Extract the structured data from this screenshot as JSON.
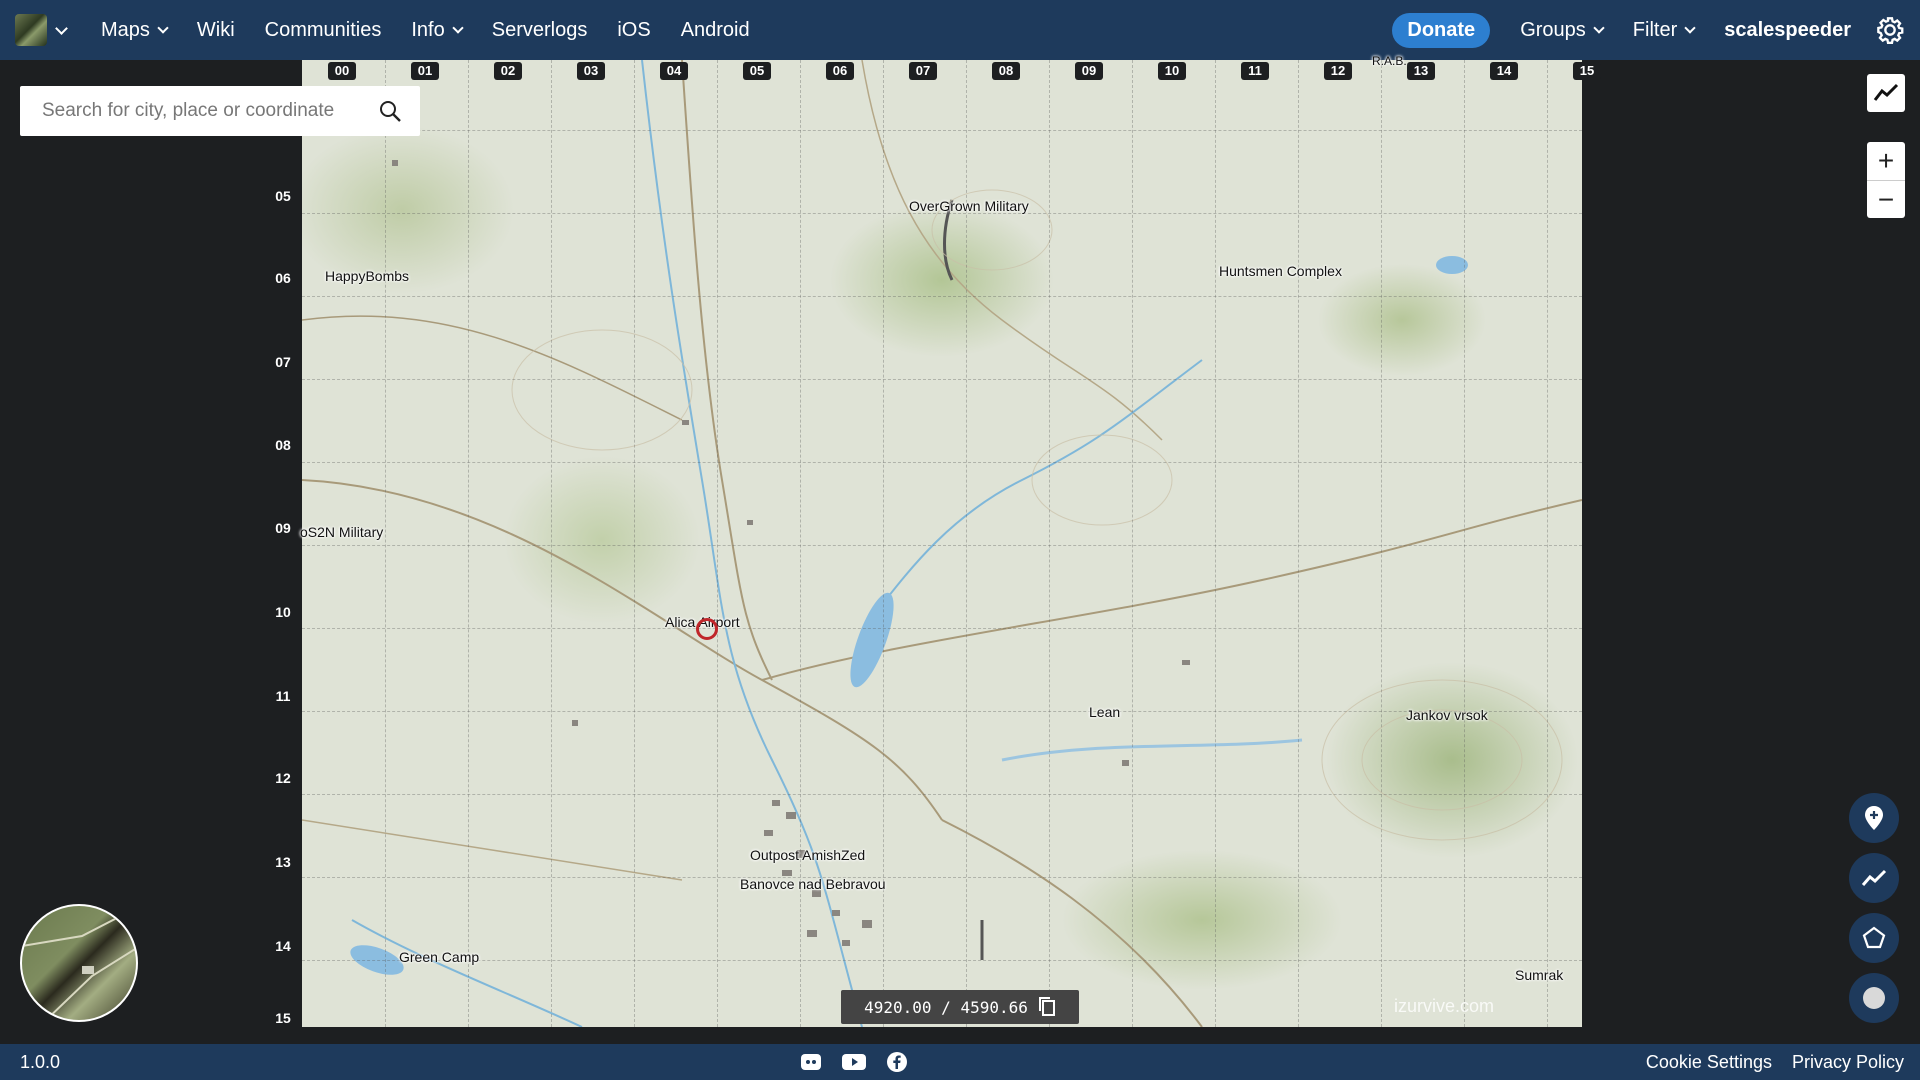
{
  "navbar": {
    "logo_icon": "map-game-logo",
    "items": [
      {
        "label": "Maps",
        "dropdown": true
      },
      {
        "label": "Wiki",
        "dropdown": false
      },
      {
        "label": "Communities",
        "dropdown": false
      },
      {
        "label": "Info",
        "dropdown": true
      },
      {
        "label": "Serverlogs",
        "dropdown": false
      },
      {
        "label": "iOS",
        "dropdown": false
      },
      {
        "label": "Android",
        "dropdown": false
      }
    ],
    "donate_label": "Donate",
    "groups_label": "Groups",
    "filter_label": "Filter",
    "username": "scalespeeder",
    "settings_icon": "gear-icon",
    "bg_color": "#1e3a5c",
    "donate_color": "#2d7fd0"
  },
  "search": {
    "placeholder": "Search for city, place or coordinate",
    "icon": "search-icon"
  },
  "grid": {
    "columns": [
      "00",
      "01",
      "02",
      "03",
      "04",
      "05",
      "06",
      "07",
      "08",
      "09",
      "10",
      "11",
      "12",
      "13",
      "14",
      "15"
    ],
    "rows": [
      "05",
      "06",
      "07",
      "08",
      "09",
      "10",
      "11",
      "12",
      "13",
      "14",
      "15"
    ]
  },
  "places": [
    {
      "name": "R.A.B.",
      "id": "rab"
    },
    {
      "name": "OverGrown Military",
      "id": "overgrown-military"
    },
    {
      "name": "HappyBombs",
      "id": "happybombs"
    },
    {
      "name": "Huntsmen Complex",
      "id": "huntsmen-complex"
    },
    {
      "name": "oS2N Military",
      "id": "os2n-military"
    },
    {
      "name": "Alica Airport",
      "id": "alica-airport"
    },
    {
      "name": "Lean",
      "id": "lean"
    },
    {
      "name": "Jankov vrsok",
      "id": "jankov-vrsok"
    },
    {
      "name": "Outpost AmishZed",
      "id": "outpost-amishzed"
    },
    {
      "name": "Banovce nad Bebravou",
      "id": "banovce"
    },
    {
      "name": "Green Camp",
      "id": "green-camp"
    },
    {
      "name": "Sumrak",
      "id": "sumrak"
    }
  ],
  "watermark": "izurvive.com",
  "coordinates": {
    "value": "4920.00 / 4590.66",
    "copy_icon": "copy-icon"
  },
  "controls": {
    "measure_icon": "line-chart-icon",
    "zoom_in": "+",
    "zoom_out": "−",
    "tools": [
      "map-pin-add-icon",
      "polyline-icon",
      "polygon-icon",
      "circle-icon"
    ]
  },
  "minimap_icon": "satellite-layer-icon",
  "footer": {
    "version": "1.0.0",
    "social_icons": [
      "discord-icon",
      "youtube-icon",
      "facebook-icon"
    ],
    "cookie_settings": "Cookie Settings",
    "privacy_policy": "Privacy Policy"
  }
}
